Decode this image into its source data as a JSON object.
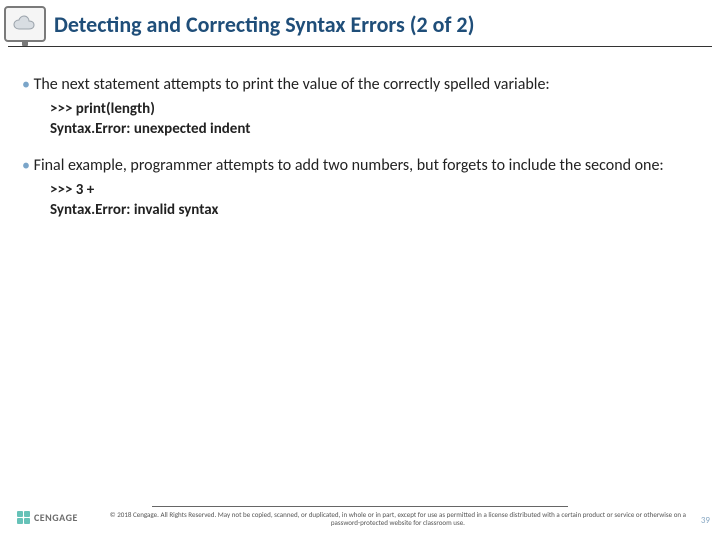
{
  "header": {
    "title": "Detecting and Correcting Syntax Errors (2 of 2)"
  },
  "content": {
    "bullet1": "The next statement attempts to print the value of the correctly spelled variable:",
    "code1_line1": ">>> print(length)",
    "code1_line2": "Syntax.Error: unexpected indent",
    "bullet2": "Final example, programmer attempts to add two numbers, but forgets to include the second one:",
    "code2_line1": ">>> 3 +",
    "code2_line2": "Syntax.Error: invalid syntax"
  },
  "footer": {
    "logo_text": "CENGAGE",
    "copyright": "© 2018 Cengage. All Rights Reserved. May not be copied, scanned, or duplicated, in whole or in part, except for use as permitted in a license distributed with a certain product or service or otherwise on a password-protected website for classroom use.",
    "page_number": "39"
  }
}
